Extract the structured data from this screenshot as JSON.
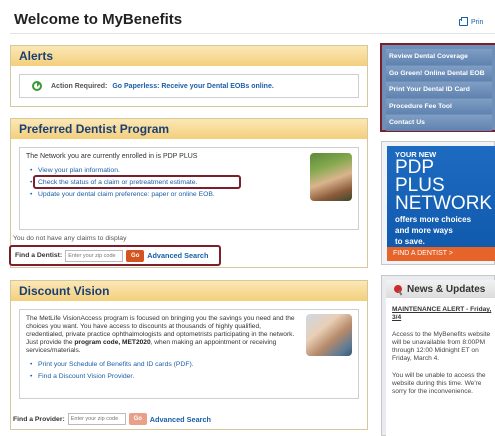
{
  "header": {
    "title": "Welcome to MyBenefits",
    "print_label": "Prin"
  },
  "alerts": {
    "title": "Alerts",
    "prefix": "Action Required:",
    "link": "Go Paperless: Receive your Dental EOBs online."
  },
  "dentist": {
    "title": "Preferred Dentist Program",
    "network_text": "The Network you are currently enrolled in is PDP PLUS",
    "links": [
      "View your plan information.",
      "Check the status of a claim or pretreatment estimate.",
      "Update your dental claim preference: paper or online EOB."
    ],
    "no_claims": "You do not have any claims to display",
    "find_label": "Find a Dentist:",
    "zip_placeholder": "Enter your zip code",
    "go": "Go",
    "advanced": "Advanced Search"
  },
  "vision": {
    "title": "Discount Vision",
    "description_start": "The MetLife VisionAccess program is focused on bringing you the savings you need and the choices you want. You have access to discounts at thousands of highly qualified, credentialed, private practice ophthalmologists and optometrists participating in the network. Just provide the ",
    "description_bold": "program code, MET2020",
    "description_end": ", when making an appointment or receiving services/materials.",
    "links": [
      "Print your Schedule of Benefits and ID cards (PDF).",
      "Find a Discount Vision Provider."
    ],
    "find_label": "Find a Provider:",
    "zip_placeholder": "Enter your zip code",
    "go": "Go",
    "advanced": "Advanced Search"
  },
  "side_menu": {
    "items": [
      "Review Dental Coverage",
      "Go Green! Online Dental EOB",
      "Print Your Dental ID Card",
      "Procedure Fee Tool",
      "Contact Us"
    ]
  },
  "ad": {
    "line1": "YOUR NEW",
    "line2": "PDP PLUS",
    "line3": "NETWORK",
    "line4": "offers more choices",
    "line5": "and more ways",
    "line6": "to save.",
    "cta": "FIND A DENTIST >"
  },
  "news": {
    "title": "News & Updates",
    "alert_title": "MAINTENANCE ALERT - Friday, 3/4",
    "p1": "Access to the MyBenefits website will be unavailable from 8:00PM through 12:00 Midnight ET on Friday, March 4.",
    "p2": "You will be unable to access the website during this time. We're sorry for the inconvenience."
  },
  "colors": {
    "link": "#1a5fa8",
    "highlight": "#7a1f2b",
    "go_button": "#d4541f",
    "header_gradient": "#f3cf7c"
  }
}
